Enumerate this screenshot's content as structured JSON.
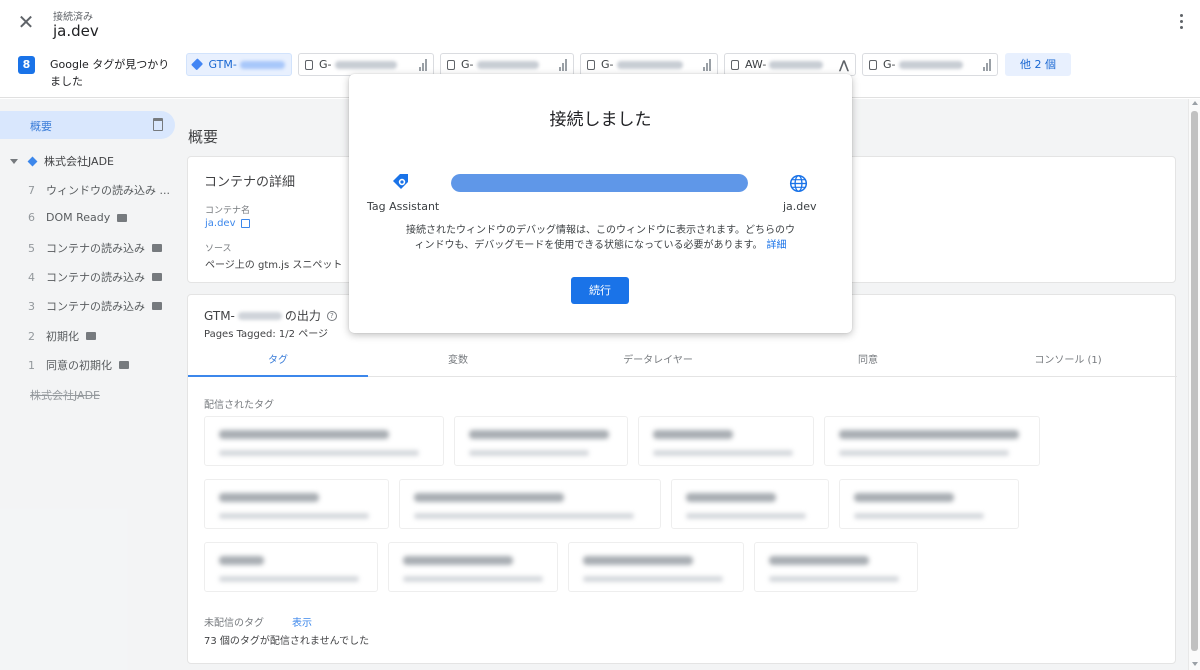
{
  "header": {
    "status_label": "接続済み",
    "domain": "ja.dev"
  },
  "tagbar": {
    "count": "8",
    "found_text": "Google タグが見つかりました",
    "chips": [
      {
        "prefix": "GTM-",
        "kind": "gtm",
        "active": true
      },
      {
        "prefix": "G-",
        "kind": "ga"
      },
      {
        "prefix": "G-",
        "kind": "ga"
      },
      {
        "prefix": "G-",
        "kind": "ga"
      },
      {
        "prefix": "AW-",
        "kind": "ads"
      },
      {
        "prefix": "G-",
        "kind": "ga"
      }
    ],
    "more_label": "他 2 個"
  },
  "sidebar": {
    "overview_label": "概要",
    "container_name": "株式会社JADE",
    "events": [
      {
        "num": "7",
        "label": "ウィンドウの読み込み ...",
        "icon": false
      },
      {
        "num": "6",
        "label": "DOM Ready",
        "icon": true
      },
      {
        "num": "5",
        "label": "コンテナの読み込み",
        "icon": true
      },
      {
        "num": "4",
        "label": "コンテナの読み込み",
        "icon": true
      },
      {
        "num": "3",
        "label": "コンテナの読み込み",
        "icon": true
      },
      {
        "num": "2",
        "label": "初期化",
        "icon": true
      },
      {
        "num": "1",
        "label": "同意の初期化",
        "icon": true
      }
    ],
    "footer_label": "株式会社JADE"
  },
  "main": {
    "page_title": "概要",
    "container_card": {
      "title": "コンテナの詳細",
      "name_label": "コンテナ名",
      "name_value": "ja.dev",
      "source_label": "ソース",
      "source_value": "ページ上の gtm.js スニペット"
    },
    "output_card": {
      "title_prefix": "GTM-",
      "title_suffix": "の出力",
      "pages_tagged": "Pages Tagged: 1/2 ページ",
      "tabs": [
        "タグ",
        "変数",
        "データレイヤー",
        "同意",
        "コンソール (1)"
      ],
      "fired_label": "配信されたタグ",
      "unfired_label": "未配信のタグ",
      "unfired_link": "表示",
      "unfired_note": "73 個のタグが配信されませんでした"
    }
  },
  "modal": {
    "title": "接続しました",
    "left_label": "Tag Assistant",
    "right_label": "ja.dev",
    "progress": 1.0,
    "body_text": "接続されたウィンドウのデバッグ情報は、このウィンドウに表示されます。どちらのウィンドウも、デバッグモードを使用できる状態になっている必要があります。",
    "detail_link": "詳細",
    "continue_label": "続行"
  },
  "colors": {
    "accent": "#1a73e8",
    "selected_bg": "#d3e3fd",
    "progress_fill": "#5f97e8"
  }
}
